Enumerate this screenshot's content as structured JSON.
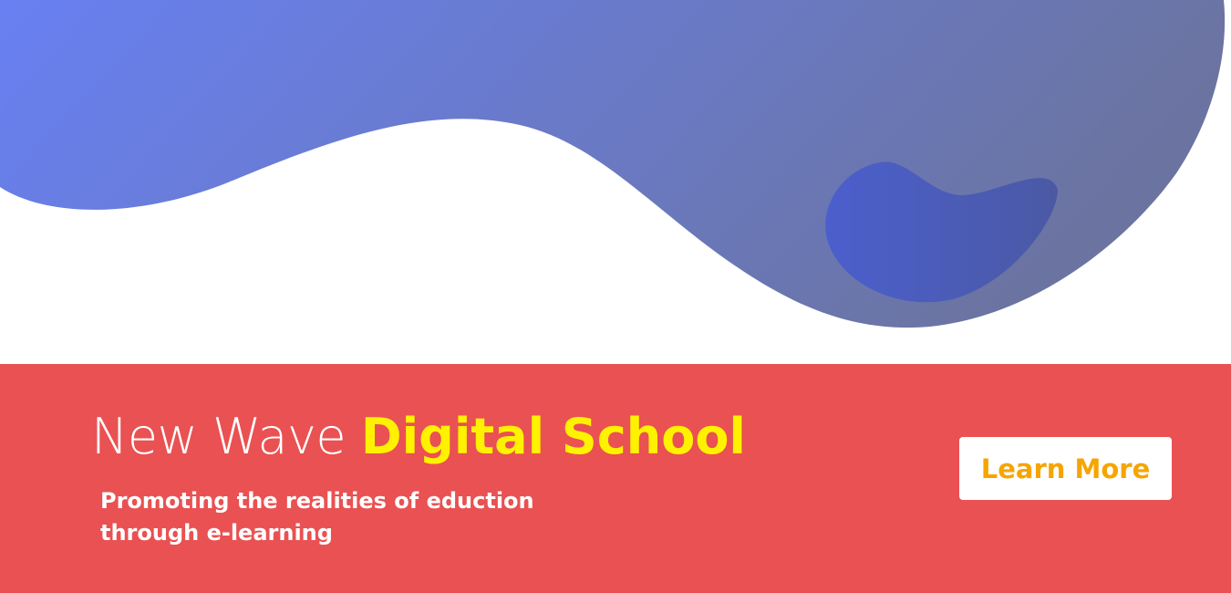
{
  "colors": {
    "banner_background": "#ea5152",
    "wave_gradient_start": "#6880f2",
    "wave_gradient_end": "#6b74a0",
    "blob_gradient_start": "#4b5fcd",
    "blob_gradient_end": "#4b59a4",
    "headline_text": "#ffffff",
    "headline_accent": "#fff200",
    "tagline_text": "#ffffff",
    "button_background": "#ffffff",
    "button_text": "#f6a500"
  },
  "banner": {
    "headline_plain": "New Wave ",
    "headline_accent": "Digital School",
    "tagline_line1": "Promoting the realities of eduction",
    "tagline_line2": "through e-learning",
    "cta_label": "Learn More"
  }
}
